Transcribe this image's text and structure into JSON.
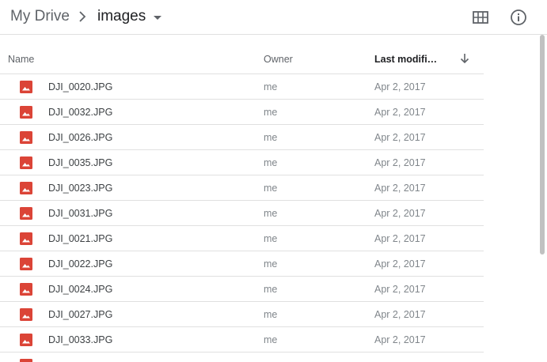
{
  "breadcrumb": {
    "root": "My Drive",
    "current": "images"
  },
  "header_icons": {
    "grid": "grid-view-icon",
    "info": "info-icon"
  },
  "columns": {
    "name": "Name",
    "owner": "Owner",
    "modified": "Last modifi…",
    "sort": "arrow-down-icon"
  },
  "file_icon": "image-file-icon",
  "accent_color": "#db4437",
  "files": [
    {
      "name": "DJI_0020.JPG",
      "owner": "me",
      "modified": "Apr 2, 2017"
    },
    {
      "name": "DJI_0032.JPG",
      "owner": "me",
      "modified": "Apr 2, 2017"
    },
    {
      "name": "DJI_0026.JPG",
      "owner": "me",
      "modified": "Apr 2, 2017"
    },
    {
      "name": "DJI_0035.JPG",
      "owner": "me",
      "modified": "Apr 2, 2017"
    },
    {
      "name": "DJI_0023.JPG",
      "owner": "me",
      "modified": "Apr 2, 2017"
    },
    {
      "name": "DJI_0031.JPG",
      "owner": "me",
      "modified": "Apr 2, 2017"
    },
    {
      "name": "DJI_0021.JPG",
      "owner": "me",
      "modified": "Apr 2, 2017"
    },
    {
      "name": "DJI_0022.JPG",
      "owner": "me",
      "modified": "Apr 2, 2017"
    },
    {
      "name": "DJI_0024.JPG",
      "owner": "me",
      "modified": "Apr 2, 2017"
    },
    {
      "name": "DJI_0027.JPG",
      "owner": "me",
      "modified": "Apr 2, 2017"
    },
    {
      "name": "DJI_0033.JPG",
      "owner": "me",
      "modified": "Apr 2, 2017"
    }
  ]
}
